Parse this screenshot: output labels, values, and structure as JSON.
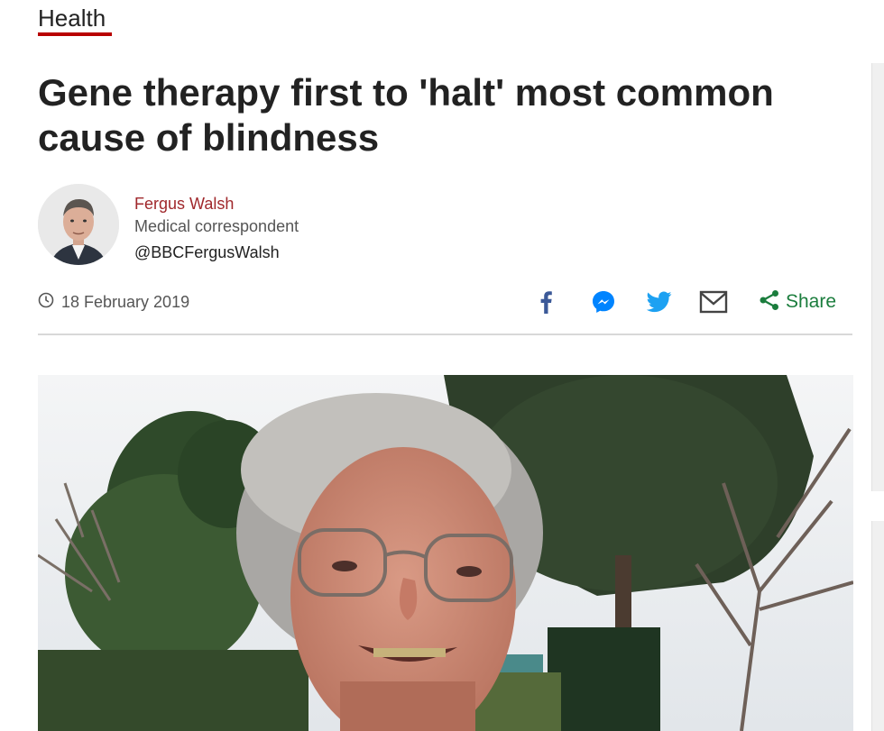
{
  "section": {
    "label": "Health"
  },
  "article": {
    "headline": "Gene therapy first to 'halt' most common cause of blindness",
    "author": {
      "name": "Fergus Walsh",
      "role": "Medical correspondent",
      "handle": "@BBCFergusWalsh"
    },
    "date": "18 February 2019"
  },
  "share": {
    "label": "Share",
    "icons": [
      "facebook-icon",
      "messenger-icon",
      "twitter-icon",
      "email-icon",
      "share-icon"
    ]
  },
  "colors": {
    "accent_red": "#b80000",
    "author_name": "#a0282c",
    "facebook": "#3b5998",
    "messenger": "#0084ff",
    "twitter": "#1da1f2",
    "share_green": "#1b7d3d"
  }
}
